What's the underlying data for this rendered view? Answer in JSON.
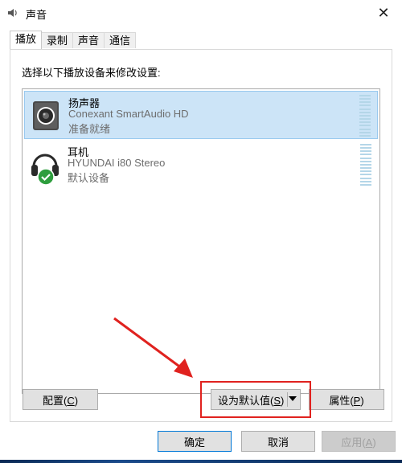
{
  "window": {
    "title": "声音",
    "close_glyph": "✕"
  },
  "tabs": [
    {
      "label": "播放",
      "active": true
    },
    {
      "label": "录制",
      "active": false
    },
    {
      "label": "声音",
      "active": false
    },
    {
      "label": "通信",
      "active": false
    }
  ],
  "panel": {
    "instruction": "选择以下播放设备来修改设置:",
    "devices": [
      {
        "name": "扬声器",
        "description": "Conexant SmartAudio HD",
        "status": "准备就绪",
        "selected": true,
        "icon": "speaker-icon"
      },
      {
        "name": "耳机",
        "description": "HYUNDAI i80 Stereo",
        "status": "默认设备",
        "selected": false,
        "icon": "headphones-icon",
        "badge": "default-check-icon"
      }
    ]
  },
  "buttons": {
    "configure": {
      "text": "配置",
      "key": "C"
    },
    "set_default": {
      "text": "设为默认值",
      "key": "S"
    },
    "properties": {
      "text": "属性",
      "key": "P"
    },
    "ok": "确定",
    "cancel": "取消",
    "apply": {
      "text": "应用",
      "key": "A"
    }
  },
  "colors": {
    "selection": "#cce4f7",
    "highlight_box": "#e0221f",
    "default_badge": "#2e9e3e"
  }
}
